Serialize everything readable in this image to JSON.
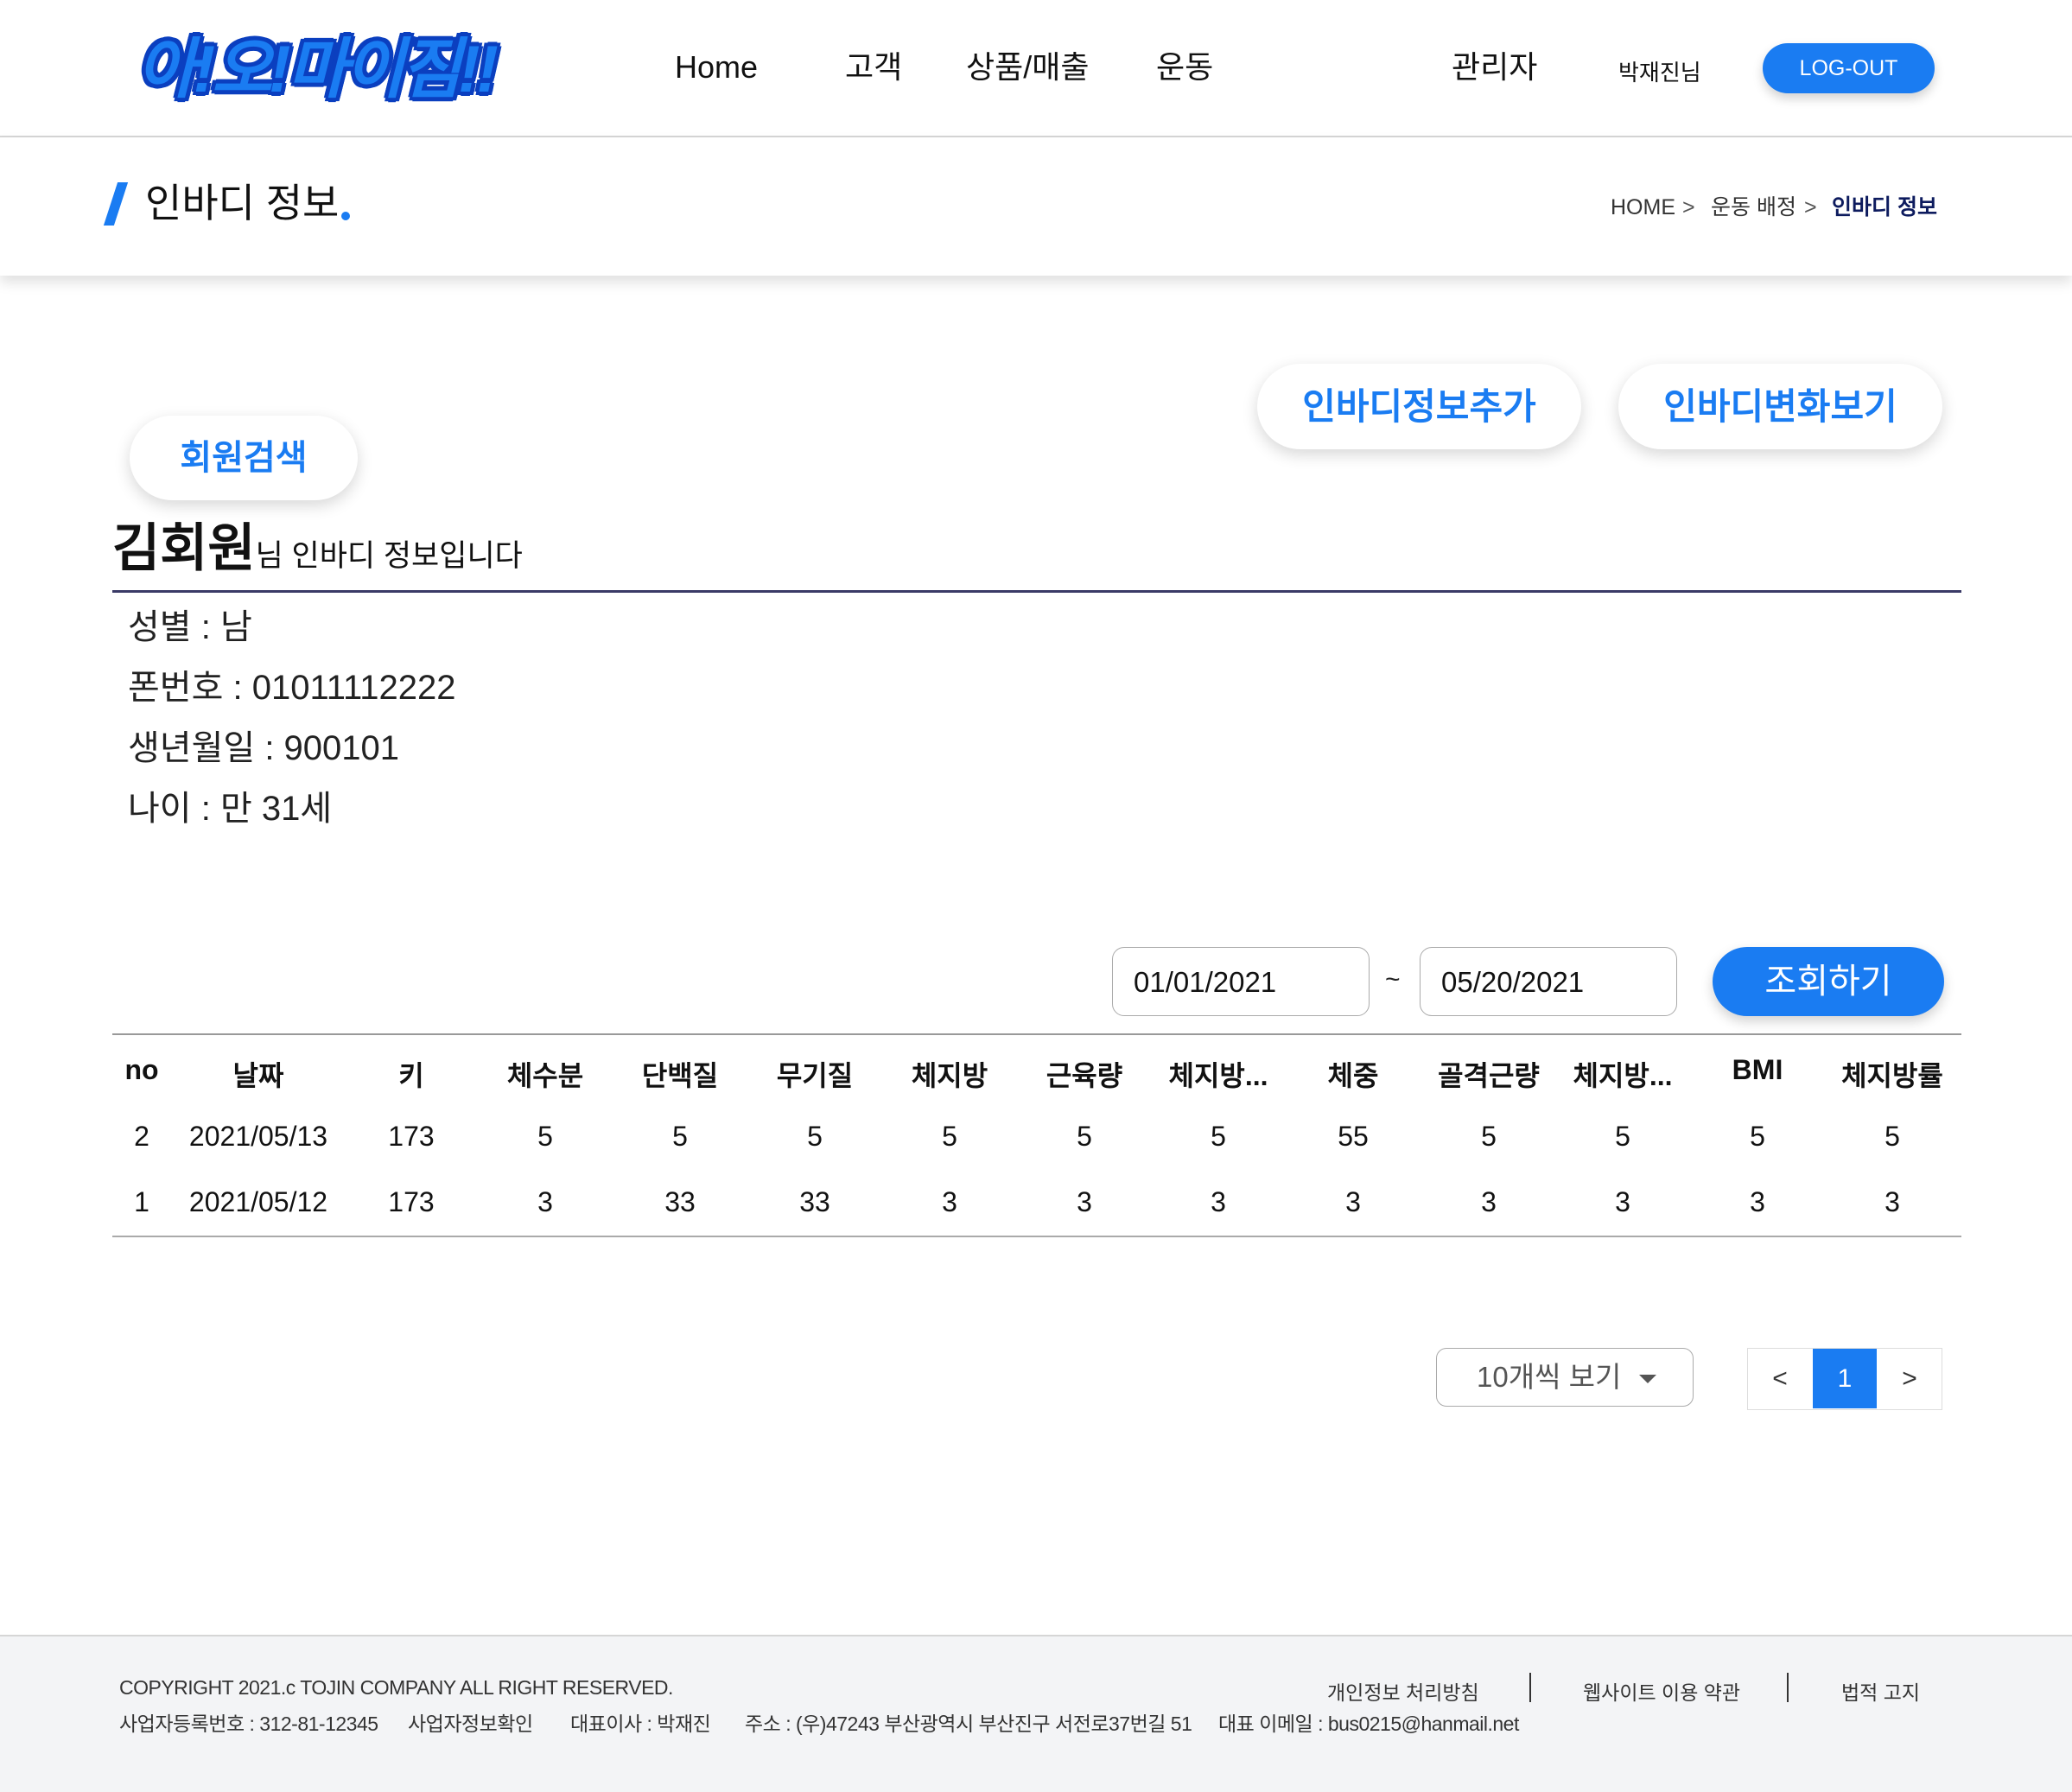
{
  "header": {
    "logo_text": "아!오!마이짐!!",
    "nav": [
      "Home",
      "고객",
      "상품/매출",
      "운동",
      "관리자"
    ],
    "user_name": "박재진님",
    "logout_label": "LOG-OUT"
  },
  "titlebar": {
    "title": "인바디 정보",
    "breadcrumb": [
      "HOME",
      ">",
      "운동 배정",
      ">",
      "인바디 정보"
    ]
  },
  "actions": {
    "add_label": "인바디정보추가",
    "change_label": "인바디변화보기",
    "search_label": "회원검색"
  },
  "member": {
    "name": "김회원",
    "suffix": "님 인바디 정보입니다",
    "info": [
      "성별 : 남",
      "폰번호 : 01011112222",
      "생년월일 : 900101",
      "나이 : 만 31세"
    ]
  },
  "filter": {
    "start_date": "01/01/2021",
    "separator": "~",
    "end_date": "05/20/2021",
    "query_label": "조회하기"
  },
  "table": {
    "headers": [
      "no",
      "날짜",
      "키",
      "체수분",
      "단백질",
      "무기질",
      "체지방",
      "근육량",
      "체지방...",
      "체중",
      "골격근량",
      "체지방...",
      "BMI",
      "체지방률"
    ],
    "rows": [
      [
        "2",
        "2021/05/13",
        "173",
        "5",
        "5",
        "5",
        "5",
        "5",
        "5",
        "55",
        "5",
        "5",
        "5",
        "5"
      ],
      [
        "1",
        "2021/05/12",
        "173",
        "3",
        "33",
        "33",
        "3",
        "3",
        "3",
        "3",
        "3",
        "3",
        "3",
        "3"
      ]
    ]
  },
  "pagination": {
    "page_size_label": "10개씩 보기",
    "prev": "<",
    "current": "1",
    "next": ">"
  },
  "footer": {
    "copyright": "COPYRIGHT 2021.c TOJIN COMPANY ALL RIGHT RESERVED.",
    "business_no": "사업자등록번호 : 312-81-12345",
    "business_info": "사업자정보확인",
    "ceo": "대표이사 : 박재진",
    "address": "주소 : (우)47243 부산광역시 부산진구 서전로37번길 51",
    "email": "대표 이메일 : bus0215@hanmail.net",
    "links": [
      "개인정보 처리방침",
      "웹사이트 이용 약관",
      "법적 고지"
    ]
  },
  "colors": {
    "accent": "#1a7cf2",
    "breadcrumb_current": "#0d1b5e",
    "footer_bg": "#f3f4f6"
  }
}
